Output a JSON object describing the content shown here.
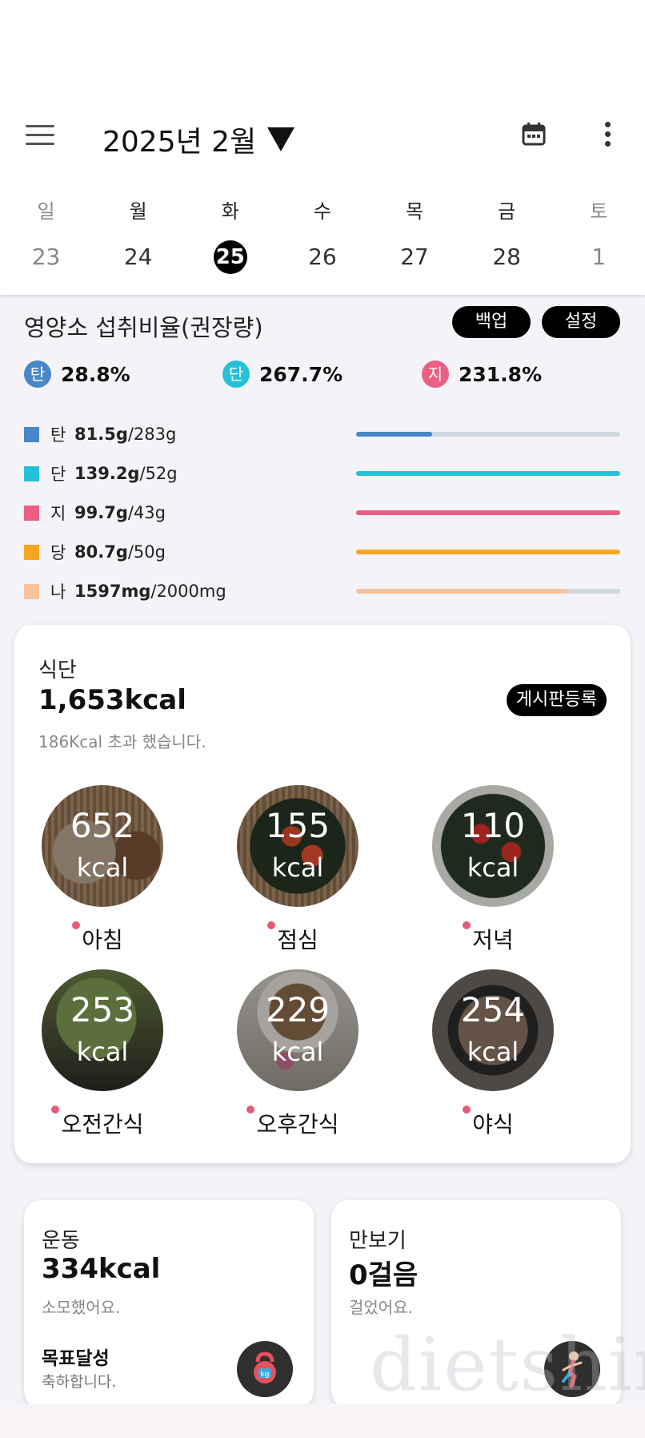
{
  "header": {
    "month_label": "2025년 2월",
    "calendar_icon": "calendar-icon",
    "more_icon": "more-vertical-icon",
    "menu_icon": "hamburger-menu-icon"
  },
  "week": [
    {
      "weekday": "일",
      "date": "23"
    },
    {
      "weekday": "월",
      "date": "24"
    },
    {
      "weekday": "화",
      "date": "25",
      "selected": true
    },
    {
      "weekday": "수",
      "date": "26"
    },
    {
      "weekday": "목",
      "date": "27"
    },
    {
      "weekday": "금",
      "date": "28"
    },
    {
      "weekday": "토",
      "date": "1"
    }
  ],
  "nutrition": {
    "title": "영양소 섭취비율(권장량)",
    "backup_label": "백업",
    "settings_label": "설정",
    "ratios": [
      {
        "badge": "탄",
        "value": "28.8%",
        "color": "#4a87c8"
      },
      {
        "badge": "단",
        "value": "267.7%",
        "color": "#25c1d6"
      },
      {
        "badge": "지",
        "value": "231.8%",
        "color": "#ea5f82"
      }
    ],
    "rows": [
      {
        "label": "탄",
        "amount": "81.5g",
        "target": "/283g",
        "color": "#4a87c8",
        "progress": 0.288
      },
      {
        "label": "단",
        "amount": "139.2g",
        "target": "/52g",
        "color": "#25c1d6",
        "progress": 1.0
      },
      {
        "label": "지",
        "amount": "99.7g",
        "target": "/43g",
        "color": "#ea5f82",
        "progress": 1.0
      },
      {
        "label": "당",
        "amount": "80.7g",
        "target": "/50g",
        "color": "#f5a623",
        "progress": 1.0
      },
      {
        "label": "나",
        "amount": "1597mg",
        "target": "/2000mg",
        "color": "#f7c39c",
        "progress": 0.8
      }
    ]
  },
  "diet": {
    "title": "식단",
    "total_kcal": "1,653kcal",
    "note": "186Kcal 초과 했습니다.",
    "post_label": "게시판등록",
    "meals": [
      {
        "name": "아침",
        "kcal": "652",
        "unit": "kcal"
      },
      {
        "name": "점심",
        "kcal": "155",
        "unit": "kcal"
      },
      {
        "name": "저녁",
        "kcal": "110",
        "unit": "kcal"
      },
      {
        "name": "오전간식",
        "kcal": "253",
        "unit": "kcal"
      },
      {
        "name": "오후간식",
        "kcal": "229",
        "unit": "kcal"
      },
      {
        "name": "야식",
        "kcal": "254",
        "unit": "kcal"
      }
    ]
  },
  "exercise": {
    "title": "운동",
    "kcal": "334kcal",
    "sub": "소모했어요.",
    "goal_title": "목표달성",
    "goal_sub": "축하합니다.",
    "icon": "kettlebell-icon"
  },
  "pedometer": {
    "title": "만보기",
    "steps": "0걸음",
    "sub": "걸었어요.",
    "icon": "running-person-icon"
  },
  "watermark": "dietshin"
}
